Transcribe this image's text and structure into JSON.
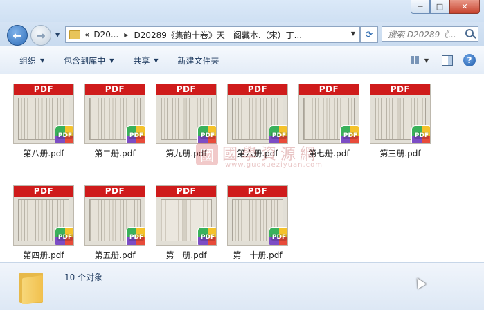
{
  "window": {
    "buttons": {
      "minimize": "─",
      "maximize": "□",
      "close": "✕"
    }
  },
  "address": {
    "overflow": "«",
    "crumbs": [
      "D20...",
      "D20289《集韵十卷》天一阁藏本.（宋）丁..."
    ],
    "search_placeholder": "搜索 D20289《..."
  },
  "toolbar": {
    "organize": "组织",
    "include_in_library": "包含到库中",
    "share": "共享",
    "new_folder": "新建文件夹"
  },
  "files": [
    {
      "name": "第八册.pdf",
      "banner": "PDF",
      "badge": "PDF"
    },
    {
      "name": "第二册.pdf",
      "banner": "PDF",
      "badge": "PDF"
    },
    {
      "name": "第九册.pdf",
      "banner": "PDF",
      "badge": "PDF"
    },
    {
      "name": "第六册.pdf",
      "banner": "PDF",
      "badge": "PDF"
    },
    {
      "name": "第七册.pdf",
      "banner": "PDF",
      "badge": "PDF"
    },
    {
      "name": "第三册.pdf",
      "banner": "PDF",
      "badge": "PDF"
    },
    {
      "name": "第四册.pdf",
      "banner": "PDF",
      "badge": "PDF"
    },
    {
      "name": "第五册.pdf",
      "banner": "PDF",
      "badge": "PDF"
    },
    {
      "name": "第一册.pdf",
      "banner": "PDF",
      "badge": "PDF"
    },
    {
      "name": "第一十册.pdf",
      "banner": "PDF",
      "badge": "PDF"
    }
  ],
  "watermark": {
    "seal": "國",
    "text": "國學資源網",
    "url": "www.guoxueziyuan.com"
  },
  "status": {
    "count": "10 个对象"
  },
  "colors": {
    "pdf_banner": "#cf1b1b",
    "toolbar_text": "#1e3a5f"
  }
}
